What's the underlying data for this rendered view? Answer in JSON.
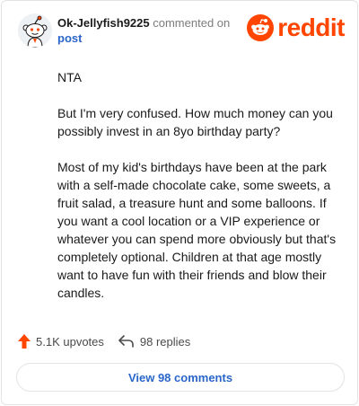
{
  "comment": {
    "username": "Ok-Jellyfish9225",
    "action_text": "commented on",
    "post_link": "post",
    "brand": "reddit",
    "paragraphs": [
      "NTA",
      "But I'm very confused. How much money can you possibly invest in an 8yo birthday party?",
      "Most of my kid's birthdays have been at the park with a self-made chocolate cake, some sweets, a fruit salad, a treasure hunt and some balloons. If you want a cool location or a VIP experience or whatever you can spend more obviously but that's completely optional. Children at that age mostly want to have fun with their friends and blow their candles."
    ]
  },
  "actions": {
    "upvotes": "5.1K upvotes",
    "replies": "98 replies"
  },
  "footer": {
    "view_comments": "View 98 comments"
  },
  "icons": {
    "upvote": "upvote-arrow-icon",
    "reply": "reply-arrow-icon",
    "logo": "reddit-snoo-icon",
    "avatar": "snoo-avatar"
  },
  "colors": {
    "brand": "#ff4500",
    "link": "#2a66c9"
  }
}
